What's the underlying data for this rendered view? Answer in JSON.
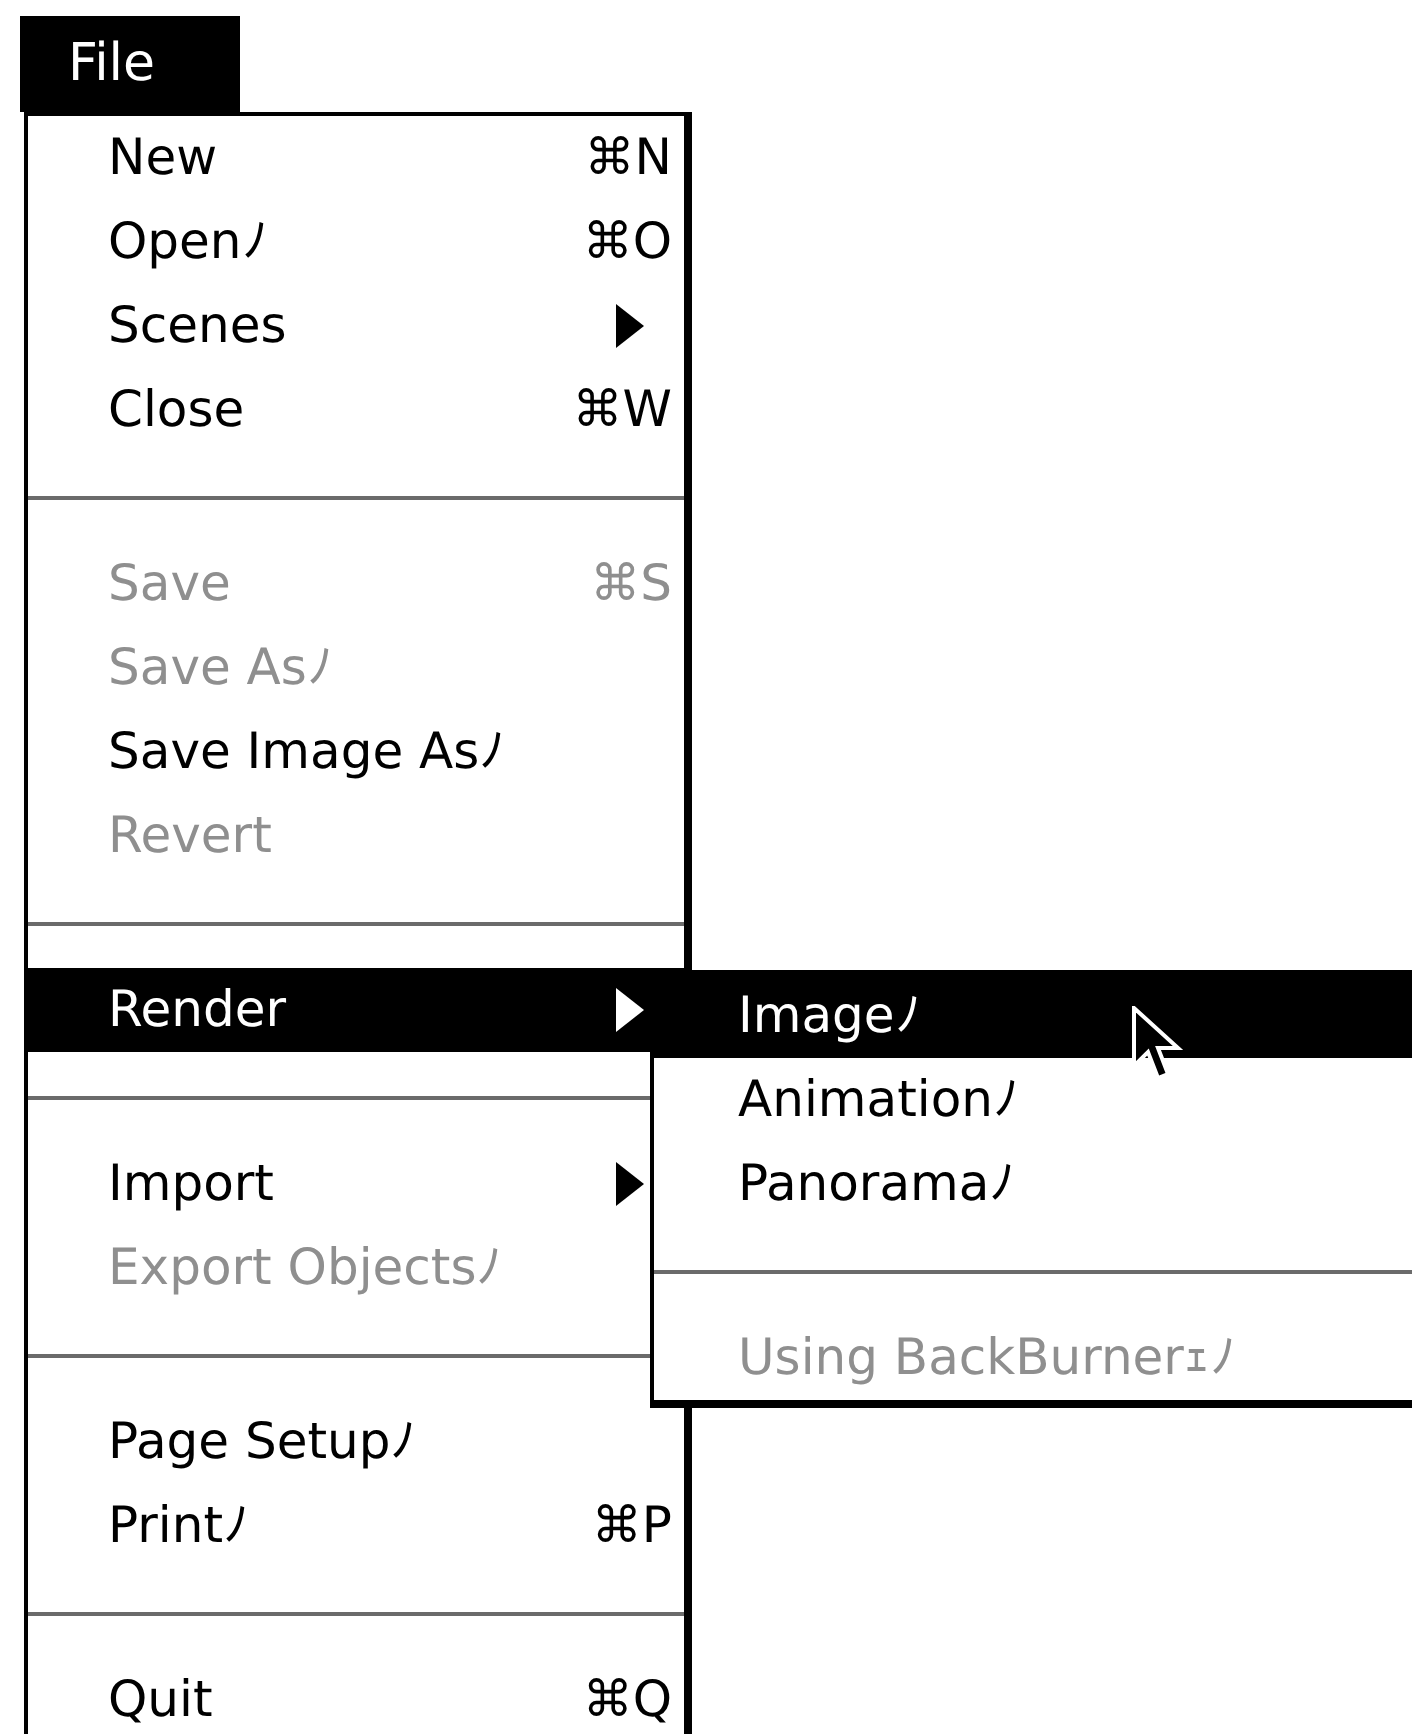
{
  "menu_bar": {
    "title": "File",
    "selected": true
  },
  "menu": {
    "items": [
      {
        "kind": "item",
        "label": "New",
        "shortcut": "⌘N",
        "disabled": false,
        "selected": false,
        "submenu": false
      },
      {
        "kind": "item",
        "label": "Openﾉ",
        "shortcut": "⌘O",
        "disabled": false,
        "selected": false,
        "submenu": false
      },
      {
        "kind": "item",
        "label": "Scenes",
        "disabled": false,
        "selected": false,
        "submenu": true
      },
      {
        "kind": "item",
        "label": "Close",
        "shortcut": "⌘W",
        "disabled": false,
        "selected": false,
        "submenu": false
      },
      {
        "kind": "separator"
      },
      {
        "kind": "item",
        "label": "Save",
        "shortcut": "⌘S",
        "disabled": true,
        "selected": false,
        "submenu": false
      },
      {
        "kind": "item",
        "label": "Save Asﾉ",
        "disabled": true,
        "selected": false,
        "submenu": false
      },
      {
        "kind": "item",
        "label": "Save Image Asﾉ",
        "disabled": false,
        "selected": false,
        "submenu": false
      },
      {
        "kind": "item",
        "label": "Revert",
        "disabled": true,
        "selected": false,
        "submenu": false
      },
      {
        "kind": "separator"
      },
      {
        "kind": "item",
        "label": "Render",
        "disabled": false,
        "selected": true,
        "submenu": true
      },
      {
        "kind": "separator"
      },
      {
        "kind": "item",
        "label": "Import",
        "disabled": false,
        "selected": false,
        "submenu": true
      },
      {
        "kind": "item",
        "label": "Export Objectsﾉ",
        "disabled": true,
        "selected": false,
        "submenu": false
      },
      {
        "kind": "separator"
      },
      {
        "kind": "item",
        "label": "Page Setupﾉ",
        "disabled": false,
        "selected": false,
        "submenu": false
      },
      {
        "kind": "item",
        "label": "Printﾉ",
        "shortcut": "⌘P",
        "disabled": false,
        "selected": false,
        "submenu": false
      },
      {
        "kind": "separator"
      },
      {
        "kind": "item",
        "label": "Quit",
        "shortcut": "⌘Q",
        "disabled": false,
        "selected": false,
        "submenu": false
      }
    ]
  },
  "submenu": {
    "items": [
      {
        "kind": "item",
        "label": "Imageﾉ",
        "disabled": false,
        "selected": true
      },
      {
        "kind": "item",
        "label": "Animationﾉ",
        "disabled": false,
        "selected": false
      },
      {
        "kind": "item",
        "label": "Panoramaﾉ",
        "disabled": false,
        "selected": false
      },
      {
        "kind": "separator"
      },
      {
        "kind": "item",
        "label": "Using BackBurnerｪﾉ",
        "disabled": true,
        "selected": false
      }
    ]
  }
}
